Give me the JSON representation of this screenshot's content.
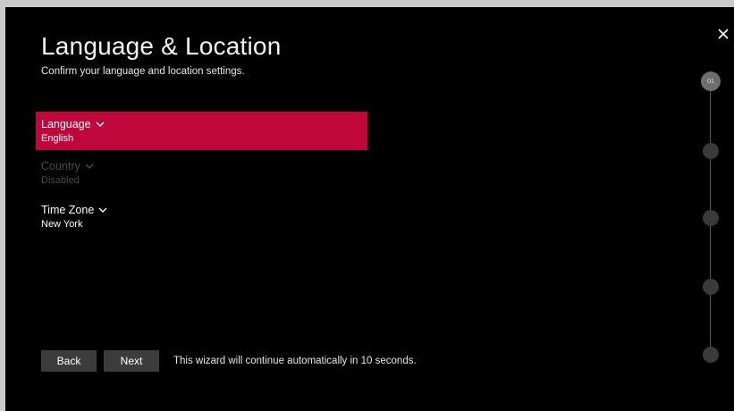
{
  "header": {
    "title": "Language & Location",
    "subtitle": "Confirm your language and location settings."
  },
  "settings": [
    {
      "label": "Language",
      "value": "English",
      "state": "focused"
    },
    {
      "label": "Country",
      "value": "Disabled",
      "state": "disabled"
    },
    {
      "label": "Time Zone",
      "value": "New York",
      "state": "normal"
    }
  ],
  "footer": {
    "back_label": "Back",
    "next_label": "Next",
    "notice": "This wizard will continue automatically in 10 seconds."
  },
  "stepper": {
    "current_step": "01",
    "total_steps": 5
  },
  "colors": {
    "accent": "#c0073c",
    "background": "#000000",
    "button": "#3c3c3c"
  },
  "icons": {
    "close": "close-icon",
    "chevron": "chevron-down-icon"
  }
}
